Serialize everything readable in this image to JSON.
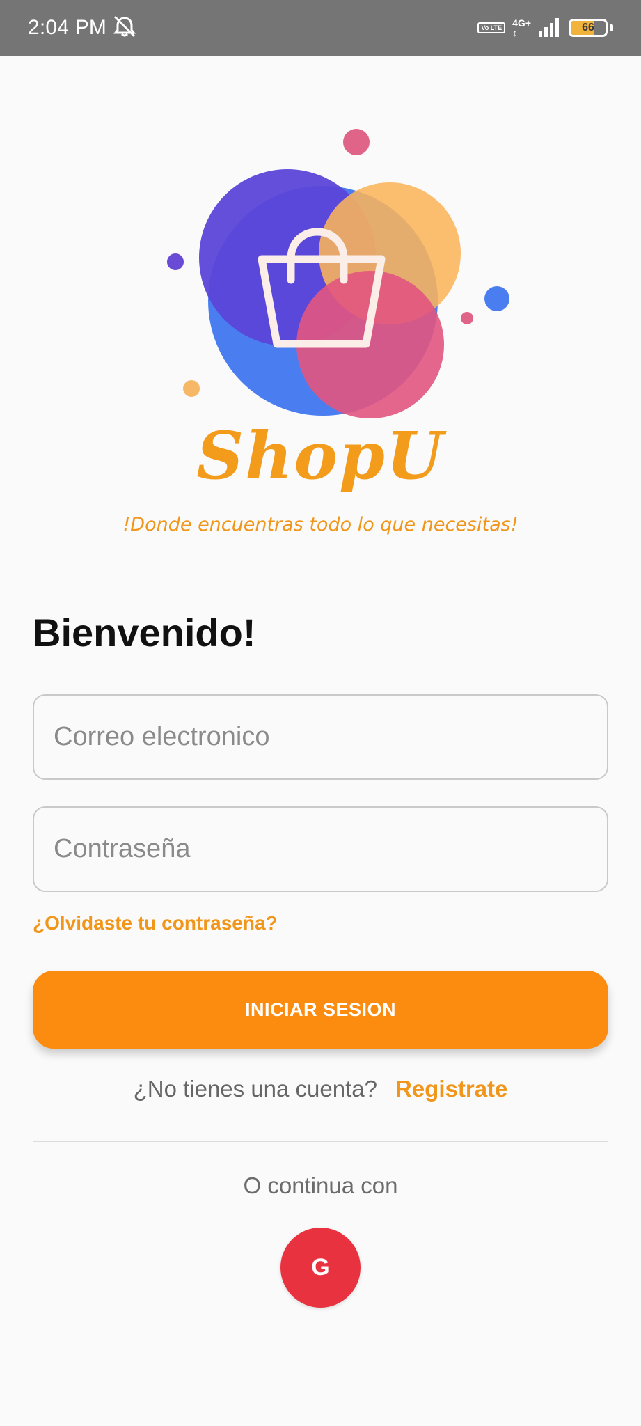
{
  "status_bar": {
    "time": "2:04 PM",
    "volte": "Vo LTE",
    "network": "4G+",
    "battery": "66",
    "battery_level": 0.66,
    "icons": [
      "mute-alarm-icon",
      "volte-icon",
      "signal-icon",
      "battery-icon"
    ]
  },
  "logo": {
    "title": "ShopU",
    "tagline": "!Donde encuentras todo lo que necesitas!",
    "icon": "shopping-basket-icon"
  },
  "login": {
    "welcome": "Bienvenido!",
    "email_placeholder": "Correo electronico",
    "password_placeholder": "Contraseña",
    "forgot": "¿Olvidaste tu contraseña?",
    "submit": "INICIAR SESION"
  },
  "register": {
    "question": "¿No tienes una cuenta?",
    "link": "Registrate"
  },
  "social": {
    "label": "O continua con",
    "google_glyph": "G",
    "google_icon": "google-icon"
  },
  "colors": {
    "accent": "#fb8c0f",
    "link": "#f0961a",
    "google": "#e8323f",
    "status_bar": "#757575"
  }
}
